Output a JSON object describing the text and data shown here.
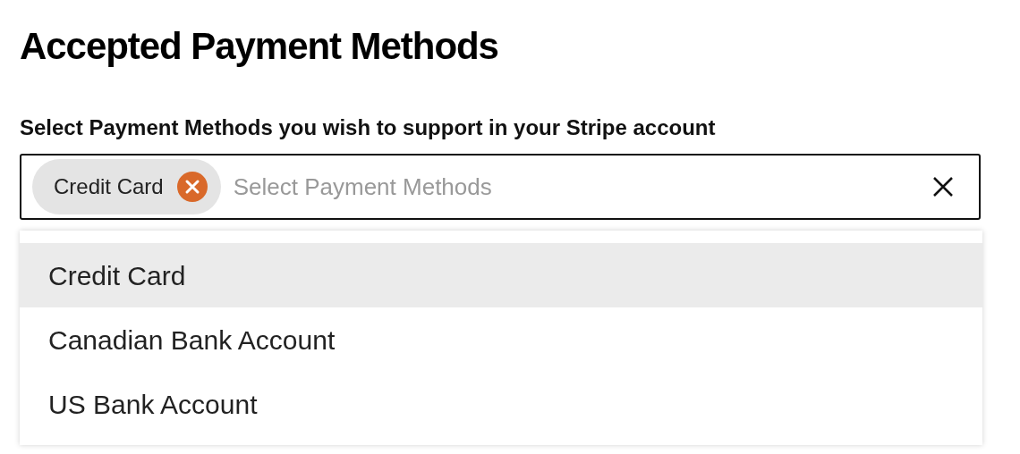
{
  "title": "Accepted Payment Methods",
  "field": {
    "label": "Select Payment Methods you wish to support in your Stripe account",
    "placeholder": "Select Payment Methods",
    "chips": [
      {
        "label": "Credit Card"
      }
    ]
  },
  "options": [
    {
      "label": "Credit Card",
      "selected": true
    },
    {
      "label": "Canadian Bank Account",
      "selected": false
    },
    {
      "label": "US Bank Account",
      "selected": false
    }
  ]
}
